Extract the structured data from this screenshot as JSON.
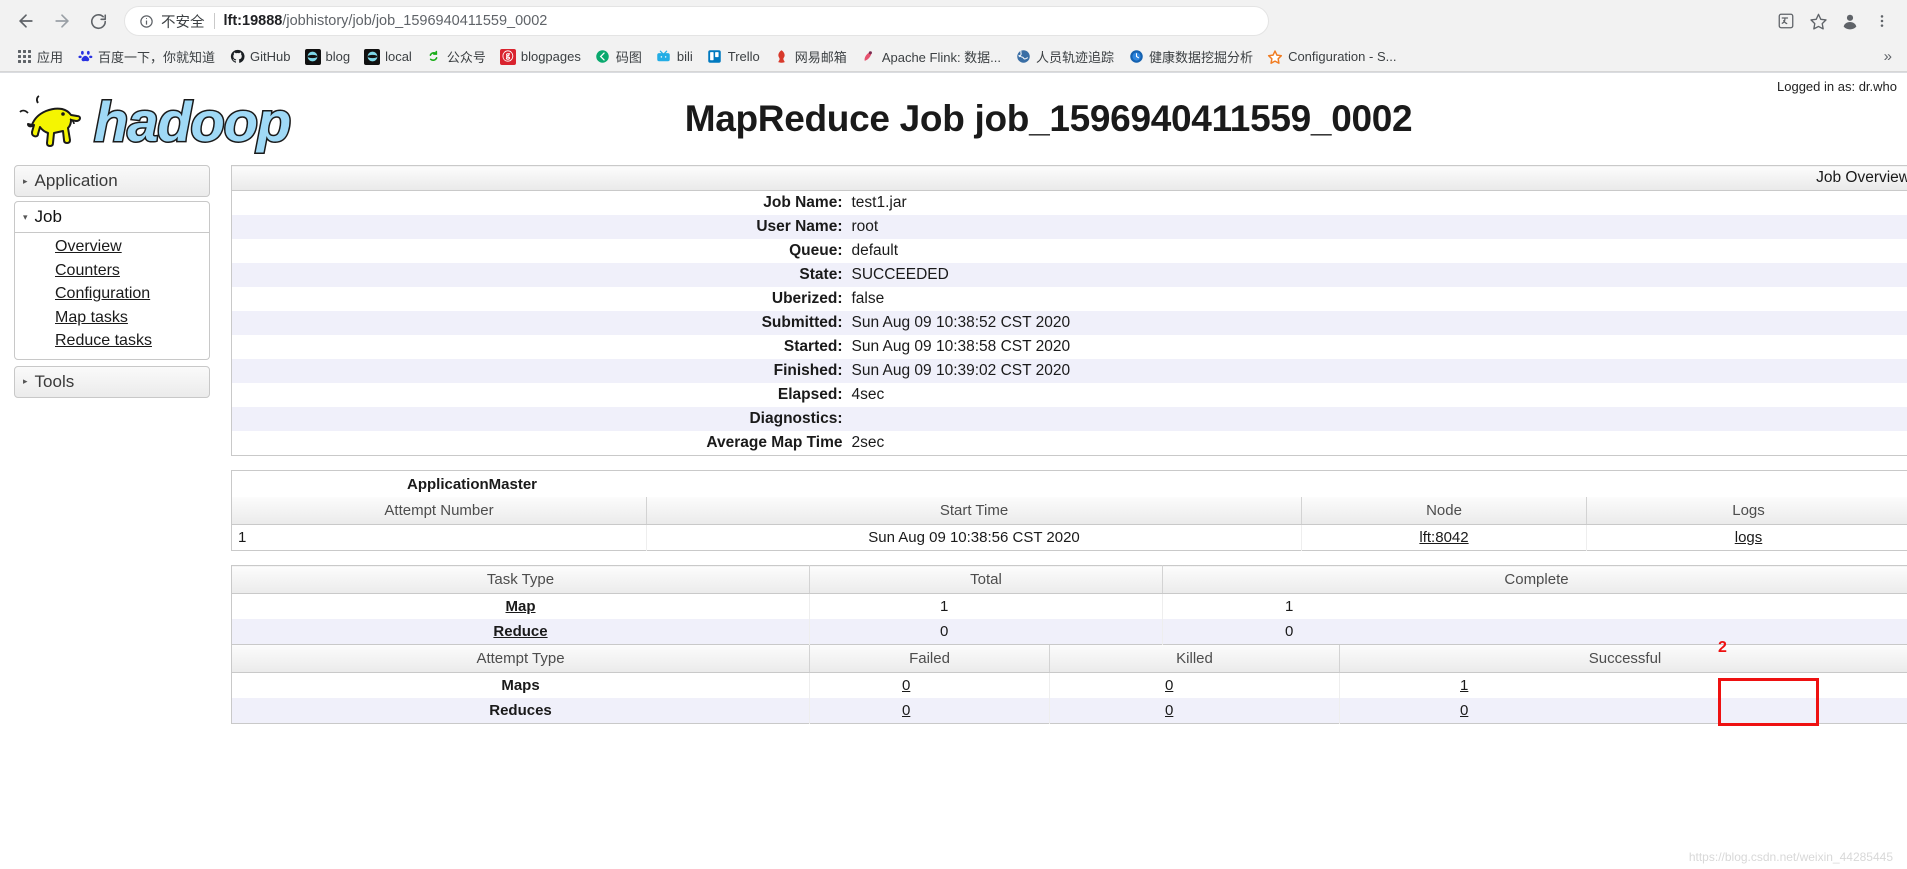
{
  "browser": {
    "back_icon": "back-arrow-icon",
    "forward_icon": "forward-arrow-icon",
    "reload_icon": "reload-icon",
    "security_label": "不安全",
    "url_host": "lft:19888",
    "url_path": "/jobhistory/job/job_1596940411559_0002",
    "translate_icon": "translate-icon",
    "bookmark_star_icon": "star-icon",
    "profile_icon": "profile-avatar-icon",
    "menu_icon": "three-dot-menu-icon",
    "overflow_label": "»",
    "bookmarks": [
      {
        "label": "应用",
        "icon": "apps-grid-icon"
      },
      {
        "label": "百度一下，你就知道",
        "icon": "baidu-icon"
      },
      {
        "label": "GitHub",
        "icon": "github-icon"
      },
      {
        "label": "blog",
        "icon": "blog-icon"
      },
      {
        "label": "local",
        "icon": "local-icon"
      },
      {
        "label": "公众号",
        "icon": "wechat-official-icon"
      },
      {
        "label": "blogpages",
        "icon": "blogpages-icon"
      },
      {
        "label": "码图",
        "icon": "matu-icon"
      },
      {
        "label": "bili",
        "icon": "bilibili-icon"
      },
      {
        "label": "Trello",
        "icon": "trello-icon"
      },
      {
        "label": "网易邮箱",
        "icon": "netease-mail-icon"
      },
      {
        "label": "Apache Flink: 数据...",
        "icon": "apache-flink-icon"
      },
      {
        "label": "人员轨迹追踪",
        "icon": "globe-icon"
      },
      {
        "label": "健康数据挖掘分析",
        "icon": "clock-icon"
      },
      {
        "label": "Configuration - S...",
        "icon": "star-orange-icon"
      }
    ]
  },
  "page": {
    "logged_in_as": "Logged in as: dr.who",
    "title": "MapReduce Job job_1596940411559_0002",
    "logo_alt": "hadoop",
    "watermark": "https://blog.csdn.net/weixin_44285445"
  },
  "sidebar": {
    "groups": [
      {
        "name": "application",
        "label": "Application",
        "expanded": false,
        "arrow": "▸",
        "links": []
      },
      {
        "name": "job",
        "label": "Job",
        "expanded": true,
        "arrow": "▾",
        "links": [
          {
            "label": "Overview"
          },
          {
            "label": "Counters"
          },
          {
            "label": "Configuration"
          },
          {
            "label": "Map tasks"
          },
          {
            "label": "Reduce tasks"
          }
        ]
      },
      {
        "name": "tools",
        "label": "Tools",
        "expanded": false,
        "arrow": "▸",
        "links": []
      }
    ]
  },
  "job_overview": {
    "caption": "Job Overview",
    "rows": [
      {
        "label": "Job Name:",
        "value": "test1.jar"
      },
      {
        "label": "User Name:",
        "value": "root"
      },
      {
        "label": "Queue:",
        "value": "default"
      },
      {
        "label": "State:",
        "value": "SUCCEEDED"
      },
      {
        "label": "Uberized:",
        "value": "false"
      },
      {
        "label": "Submitted:",
        "value": "Sun Aug 09 10:38:52 CST 2020"
      },
      {
        "label": "Started:",
        "value": "Sun Aug 09 10:38:58 CST 2020"
      },
      {
        "label": "Finished:",
        "value": "Sun Aug 09 10:39:02 CST 2020"
      },
      {
        "label": "Elapsed:",
        "value": "4sec"
      },
      {
        "label": "Diagnostics:",
        "value": ""
      },
      {
        "label": "Average Map Time",
        "value": "2sec"
      }
    ]
  },
  "application_master": {
    "title": "ApplicationMaster",
    "headers": [
      "Attempt Number",
      "Start Time",
      "Node",
      "Logs"
    ],
    "rows": [
      {
        "attempt_number": "1",
        "start_time": "Sun Aug 09 10:38:56 CST 2020",
        "node": "lft:8042",
        "logs": "logs"
      }
    ]
  },
  "task_summary": {
    "headers": [
      "Task Type",
      "Total",
      "Complete"
    ],
    "rows": [
      {
        "type": "Map",
        "total": "1",
        "complete": "1"
      },
      {
        "type": "Reduce",
        "total": "0",
        "complete": "0"
      }
    ]
  },
  "attempt_summary": {
    "headers": [
      "Attempt Type",
      "Failed",
      "Killed",
      "Successful"
    ],
    "rows": [
      {
        "type": "Maps",
        "failed": "0",
        "killed": "0",
        "successful": "1"
      },
      {
        "type": "Reduces",
        "failed": "0",
        "killed": "0",
        "successful": "0"
      }
    ]
  },
  "annotation": {
    "number": "2",
    "highlight_color": "#ee1111",
    "target": "logs"
  }
}
